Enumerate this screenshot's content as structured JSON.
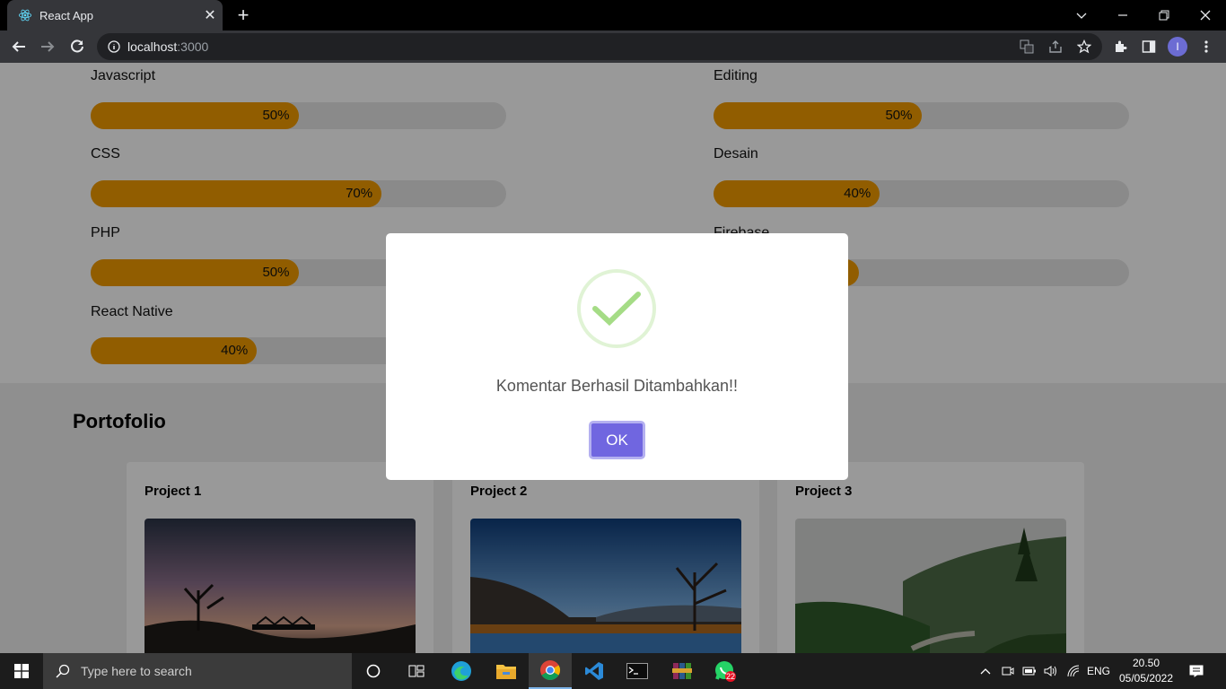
{
  "browser": {
    "tab_title": "React App",
    "new_tab_symbol": "+",
    "url_host": "localhost",
    "url_port": ":3000",
    "profile_initial": "I"
  },
  "skills": {
    "left": [
      {
        "label": "Javascript",
        "percent": 50,
        "text": "50%"
      },
      {
        "label": "CSS",
        "percent": 70,
        "text": "70%"
      },
      {
        "label": "PHP",
        "percent": 50,
        "text": "50%"
      },
      {
        "label": "React Native",
        "percent": 40,
        "text": "40%"
      }
    ],
    "right": [
      {
        "label": "Editing",
        "percent": 50,
        "text": "50%"
      },
      {
        "label": "Desain",
        "percent": 40,
        "text": "40%"
      },
      {
        "label": "Firebase",
        "percent": 35,
        "text": ""
      }
    ]
  },
  "portfolio": {
    "title": "Portofolio",
    "projects": [
      {
        "title": "Project 1"
      },
      {
        "title": "Project 2"
      },
      {
        "title": "Project 3"
      }
    ]
  },
  "modal": {
    "message": "Komentar Berhasil Ditambahkan!!",
    "ok_label": "OK"
  },
  "taskbar": {
    "search_placeholder": "Type here to search",
    "language": "ENG",
    "time": "20.50",
    "date": "05/05/2022",
    "whatsapp_badge": "22"
  },
  "colors": {
    "bar_fill": "#f29c00",
    "bar_track": "#e6e6e6",
    "ok_button": "#7066e0",
    "success_check": "#a5dc86"
  }
}
